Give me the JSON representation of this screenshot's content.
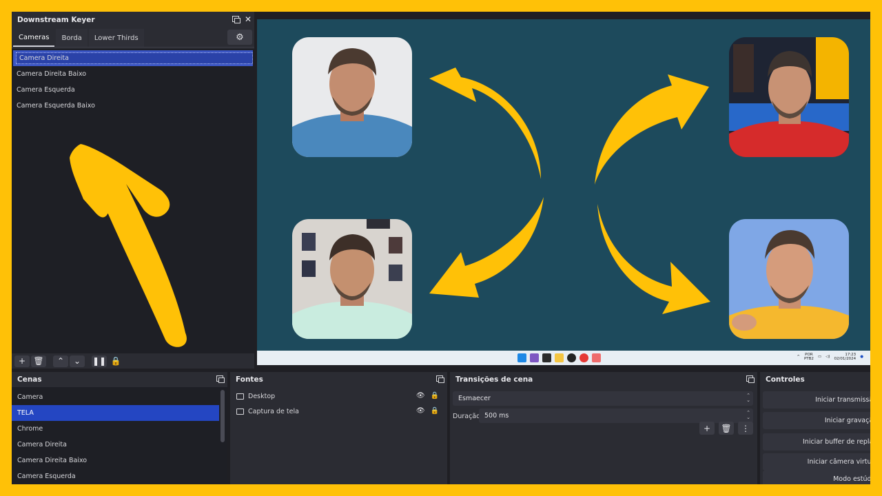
{
  "dsk": {
    "title": "Downstream Keyer",
    "tabs": [
      "Cameras",
      "Borda",
      "Lower Thirds"
    ],
    "items": [
      "Camera Direita",
      "Camera Direita Baixo",
      "Camera Esquerda",
      "Camera Esquerda Baixo"
    ]
  },
  "scenes": {
    "title": "Cenas",
    "items": [
      "Camera",
      "TELA",
      "Chrome",
      "Camera Direita",
      "Camera Direita Baixo",
      "Camera Esquerda"
    ]
  },
  "sources": {
    "title": "Fontes",
    "items": [
      "Desktop",
      "Captura de tela"
    ]
  },
  "transitions": {
    "title": "Transições de cena",
    "current": "Esmaecer",
    "duration_label": "Duração",
    "duration_value": "500 ms"
  },
  "controls": {
    "title": "Controles",
    "buttons": [
      "Iniciar transmissão",
      "Iniciar gravação",
      "Iniciar buffer de replay",
      "Iniciar câmera virtual",
      "Modo estúdio"
    ]
  },
  "taskbar": {
    "lang1": "POR",
    "lang2": "PTB2",
    "time": "17:23",
    "date": "02/01/2024"
  },
  "colors": {
    "accent": "#2446c2",
    "arrow": "#ffc107",
    "preview_bg": "#1d4a5c"
  }
}
